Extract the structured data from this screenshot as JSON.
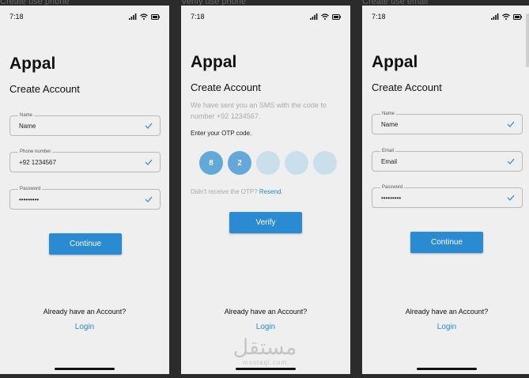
{
  "frames": [
    {
      "caption": "Create use phone",
      "time": "7:18",
      "brand": "Appal",
      "subtitle": "Create Account",
      "fields": [
        {
          "label": "Name",
          "value": "Name"
        },
        {
          "label": "Phone number",
          "value": "+92 1234567"
        },
        {
          "label": "Password",
          "value": "•••••••••"
        }
      ],
      "button": "Continue",
      "already": "Already have an Account?",
      "login": "Login"
    },
    {
      "caption": "Verify use phone",
      "time": "7:18",
      "brand": "Appal",
      "subtitle": "Create Account",
      "description": "We have sent you an SMS with the code to number +92 1234567.",
      "otp_label": "Enter your OTP code.",
      "otp_digits": [
        "8",
        "2",
        "",
        "",
        ""
      ],
      "resend_prefix": "Didn't receive the OTP? ",
      "resend_link": "Resend.",
      "button": "Verify",
      "already": "Already have an Account?",
      "login": "Login"
    },
    {
      "caption": "Create use email",
      "time": "7:18",
      "brand": "Appal",
      "subtitle": "Create Account",
      "fields": [
        {
          "label": "Name",
          "value": "Name"
        },
        {
          "label": "Email",
          "value": "Email"
        },
        {
          "label": "Password",
          "value": "•••••••••"
        }
      ],
      "button": "Continue",
      "already": "Already have an Account?",
      "login": "Login"
    }
  ],
  "watermark": {
    "arabic": "مستقل",
    "latin": "mostaql.com"
  },
  "colors": {
    "accent": "#2a8ad2",
    "otp_filled": "#62a8d8",
    "otp_empty": "#c9dfec",
    "screen_bg": "#efefef",
    "backdrop": "#2b2b2b"
  },
  "icons": [
    "signal-icon",
    "wifi-icon",
    "battery-icon",
    "check-icon"
  ]
}
